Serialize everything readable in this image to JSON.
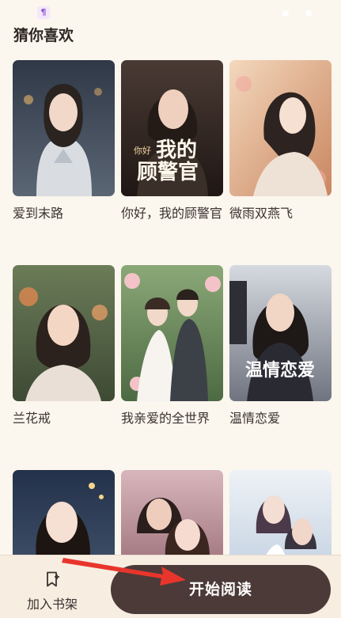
{
  "section": {
    "title": "猜你喜欢"
  },
  "books": [
    {
      "title": "爱到末路",
      "cover_text": "",
      "cover_sub": "",
      "palette": [
        "#3c4654",
        "#8a97a6",
        "#c9d2db"
      ]
    },
    {
      "title": "你好，我的顾警官",
      "cover_text": "我的顾警官",
      "cover_prefix": "你好",
      "cover_sub": "顾警官",
      "palette": [
        "#3a2a24",
        "#7a5a48",
        "#cfa688"
      ]
    },
    {
      "title": "微雨双燕飞",
      "cover_text": "",
      "cover_sub": "",
      "palette": [
        "#c98f6a",
        "#efcaa6",
        "#f6e2cf"
      ]
    },
    {
      "title": "兰花戒",
      "cover_text": "",
      "cover_sub": "",
      "palette": [
        "#6c7d58",
        "#d5a070",
        "#f2d7bf"
      ]
    },
    {
      "title": "我亲爱的全世界",
      "cover_text": "",
      "cover_sub": "",
      "palette": [
        "#5d7a4f",
        "#d8c4b2",
        "#f3e8df"
      ]
    },
    {
      "title": "温情恋爱",
      "cover_text": "温情恋爱",
      "cover_sub": "",
      "palette": [
        "#2c2b30",
        "#7a7b86",
        "#d9dce2"
      ]
    },
    {
      "title": "",
      "cover_text": "",
      "cover_sub": "",
      "palette": [
        "#23324a",
        "#c07a70",
        "#f0d3c8"
      ]
    },
    {
      "title": "",
      "cover_text": "",
      "cover_sub": "",
      "palette": [
        "#4a3a42",
        "#d19aa6",
        "#f4dcdf"
      ]
    },
    {
      "title": "",
      "cover_text": "",
      "cover_sub": "",
      "palette": [
        "#7aa0c4",
        "#d4b6c9",
        "#eef2f6"
      ]
    }
  ],
  "bottom_bar": {
    "shelf_label": "加入书架",
    "start_label": "开始阅读"
  },
  "colors": {
    "button_bg": "#4b3a38",
    "arrow": "#e8352c",
    "page_bg": "#fbf6ee"
  }
}
